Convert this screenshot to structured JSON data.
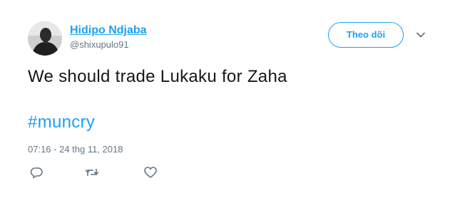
{
  "author": {
    "display_name": "Hidipo Ndjaba",
    "handle": "@shixupulo91"
  },
  "follow_button": {
    "label": "Theo dõi"
  },
  "tweet": {
    "text": "We should trade Lukaku for Zaha",
    "hashtag": "#muncry",
    "timestamp": "07:16 - 24 thg 11, 2018"
  },
  "icons": {
    "avatar": "profile-photo",
    "caret": "chevron-down-icon",
    "reply": "reply-icon",
    "retweet": "retweet-icon",
    "like": "heart-icon"
  },
  "colors": {
    "accent": "#1da1f2",
    "text": "#14171a",
    "secondary": "#657786",
    "icon": "#657786"
  }
}
